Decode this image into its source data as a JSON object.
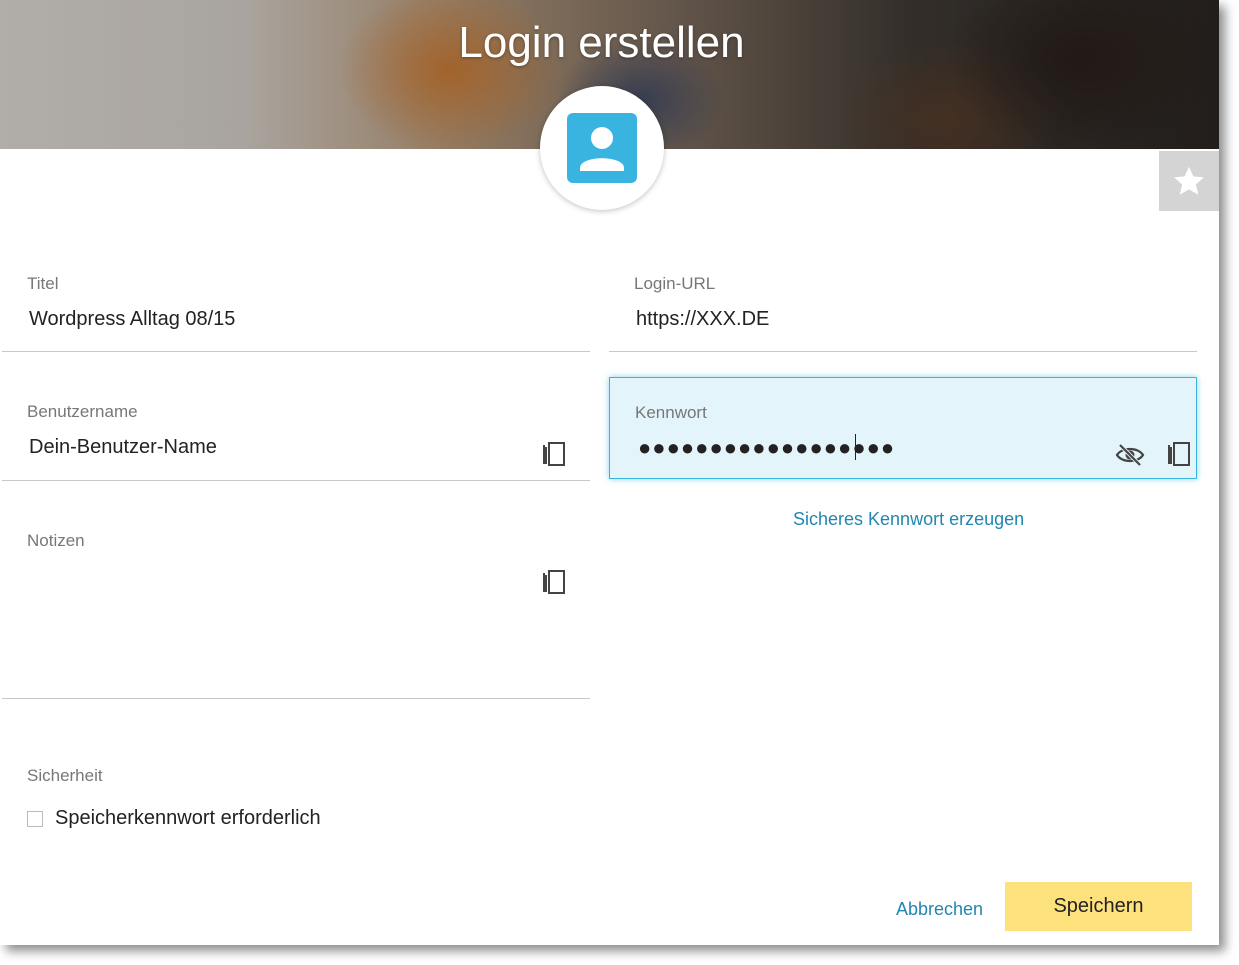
{
  "dialog": {
    "title": "Login erstellen",
    "accent_color": "#39b4e0",
    "avatar_icon": "person-card-icon",
    "favorite_icon": "star-icon"
  },
  "fields": {
    "title": {
      "label": "Titel",
      "value": "Wordpress Alltag 08/15"
    },
    "login_url": {
      "label": "Login-URL",
      "value": "https://XXX.DE"
    },
    "username": {
      "label": "Benutzername",
      "value": "Dein-Benutzer-Name"
    },
    "password": {
      "label": "Kennwort",
      "value": "●●●●●●●●●●●●●●●●●●"
    },
    "notes": {
      "label": "Notizen",
      "value": ""
    }
  },
  "password_actions": {
    "generate_label": "Sicheres Kennwort erzeugen"
  },
  "security": {
    "label": "Sicherheit",
    "checkbox_label": "Speicherkennwort erforderlich",
    "checked": false
  },
  "buttons": {
    "cancel_label": "Abbrechen",
    "save_label": "Speichern",
    "save_color": "#fde17c"
  }
}
